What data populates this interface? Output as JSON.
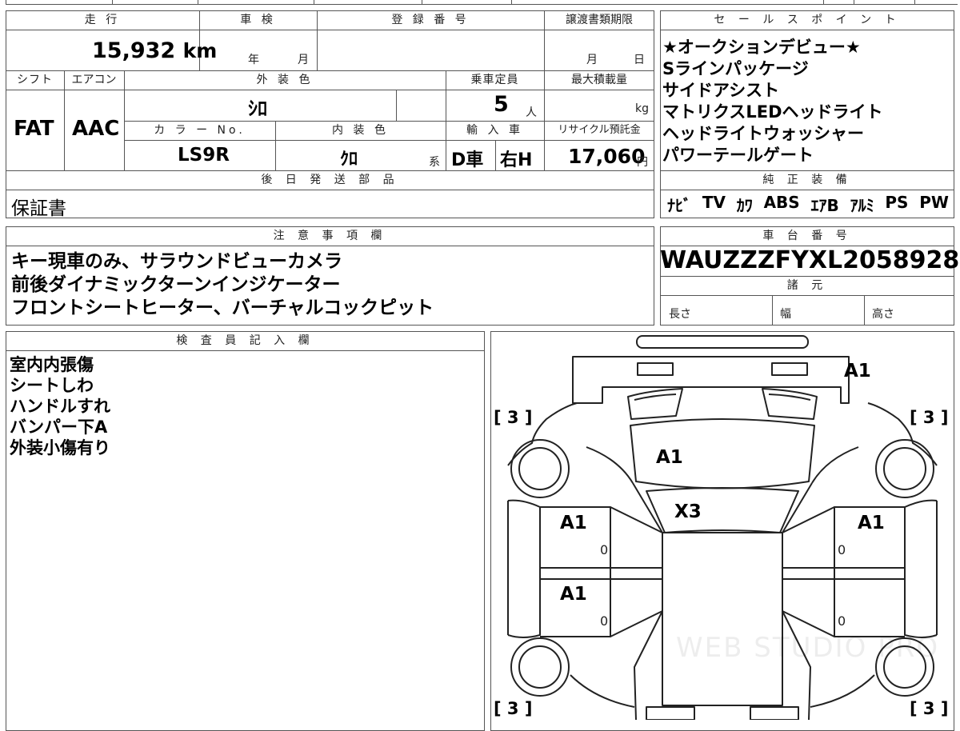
{
  "vehicle": {
    "mileage_label": "走 行",
    "mileage_value": "15,932",
    "mileage_unit": "km",
    "inspection_label": "車 検",
    "inspection_year": "年",
    "inspection_month": "月",
    "registration_label": "登 録 番 号",
    "transfer_label": "譲渡書類期限",
    "transfer_month": "月",
    "transfer_day": "日",
    "shift_label": "シフト",
    "shift_value": "FAT",
    "ac_label": "エアコン",
    "ac_value": "AAC",
    "exterior_label": "外 装 色",
    "exterior_value": "ｼﾛ",
    "color_no_label": "カ ラ ー No.",
    "color_no_value": "LS9R",
    "interior_label": "内 装 色",
    "interior_value": "ｸﾛ",
    "interior_suffix": "系",
    "capacity_label": "乗車定員",
    "capacity_value": "5",
    "capacity_unit": "人",
    "load_label": "最大積載量",
    "load_unit": "kg",
    "import_label": "輸 入 車",
    "import_value": "D車",
    "steering_value": "右H",
    "recycle_label": "リサイクル預託金",
    "recycle_value": "17,060",
    "recycle_unit": "円"
  },
  "later_parts": {
    "header": "後 日 発 送 部 品",
    "content": "保証書"
  },
  "sales_points": {
    "header": "セ ー ル ス ポ イ ン ト",
    "lines": [
      "★オークションデビュー★",
      "Sラインパッケージ",
      "サイドアシスト",
      "マトリクスLEDヘッドライト",
      "ヘッドライトウォッシャー",
      "パワーテールゲート"
    ]
  },
  "equipment": {
    "header": "純 正 装 備",
    "items": [
      "ﾅﾋﾞ",
      "TV",
      "ｶﾜ",
      "ABS",
      "ｴｱB",
      "ｱﾙﾐ",
      "PS",
      "PW"
    ]
  },
  "notes": {
    "header": "注 意 事 項 欄",
    "lines": [
      "キー現車のみ、サラウンドビューカメラ",
      "前後ダイナミックターンインジケーター",
      "フロントシートヒーター、バーチャルコックピット"
    ]
  },
  "chassis": {
    "header": "車 台 番 号",
    "value": "WAUZZZFYXL2058928",
    "specs_header": "諸 元",
    "length_label": "長さ",
    "width_label": "幅",
    "height_label": "高さ"
  },
  "inspector": {
    "header": "検 査 員 記 入 欄",
    "lines": [
      "室内内張傷",
      "シートしわ",
      "ハンドルすれ",
      "バンパー下A",
      "外装小傷有り"
    ]
  },
  "diagram": {
    "tire_marks": [
      "[ 3 ]",
      "[ 3 ]",
      "[ 3 ]",
      "[ 3 ]"
    ],
    "marks": [
      "A1",
      "A1",
      "X3",
      "A1",
      "A1",
      "A1"
    ],
    "zeros": [
      "0",
      "0",
      "0",
      "0"
    ],
    "watermark": "WEB STUDIO PRO"
  }
}
